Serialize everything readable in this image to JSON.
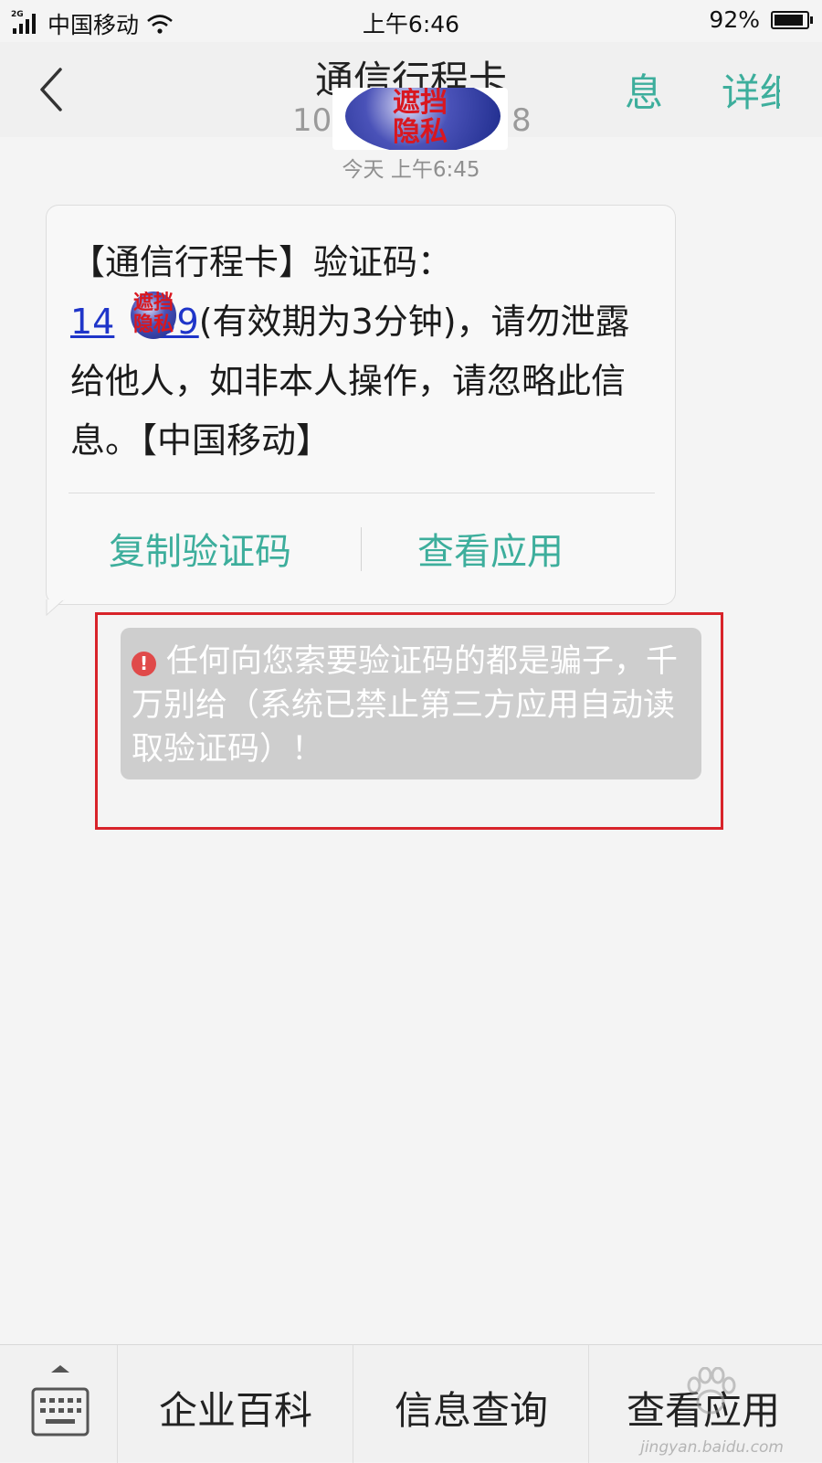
{
  "status_bar": {
    "network_type": "2G",
    "carrier": "中国移动",
    "time": "上午6:46",
    "battery_percent": "92%",
    "battery_level": 0.92,
    "signal_bars": 4
  },
  "nav": {
    "title": "通信行程卡",
    "number_prefix": "10",
    "number_suffix": "8",
    "privacy_mask_top": "遮挡",
    "privacy_mask_bottom": "隐私",
    "action_info": "息",
    "action_details": "详细"
  },
  "conversation": {
    "timestamp": "今天 上午6:45"
  },
  "message": {
    "line1": "【通信行程卡】验证码：",
    "code_prefix": "14",
    "code_suffix": "39",
    "after_code": "(有效期为3分钟)，请勿泄露给他人，如非本人操作，请忽略此信息。【中国移动】",
    "code_mask_top": "遮挡",
    "code_mask_bottom": "隐私",
    "copy_code_button": "复制验证码",
    "view_app_button": "查看应用"
  },
  "warning": {
    "icon_glyph": "!",
    "text": "任何向您索要验证码的都是骗子，千万别给（系统已禁止第三方应用自动读取验证码）！"
  },
  "bottom_menu": {
    "items": [
      {
        "label": "企业百科"
      },
      {
        "label": "信息查询"
      },
      {
        "label": "查看应用"
      }
    ],
    "watermark": "jingyan.baidu.com"
  },
  "colors": {
    "accent_teal": "#3dae9c",
    "link_blue": "#1f35c9",
    "highlight_red": "#d8232a",
    "warning_icon_red": "#e04a4a"
  }
}
